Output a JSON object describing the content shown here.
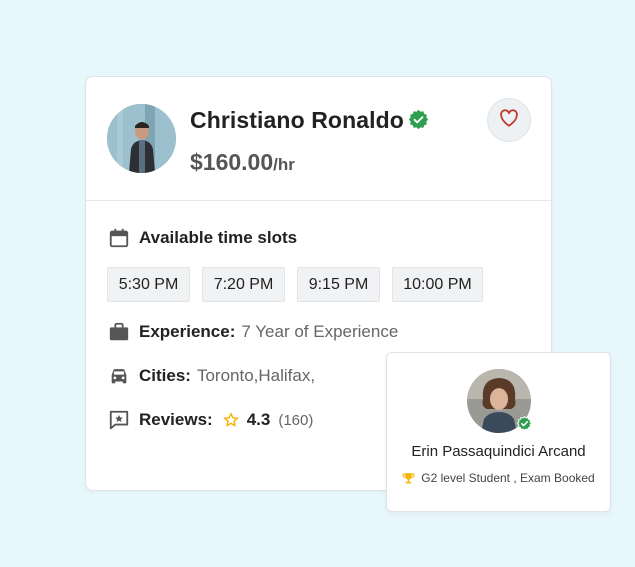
{
  "profile": {
    "name": "Christiano Ronaldo",
    "price": "$160.00",
    "price_unit": "/hr"
  },
  "availability": {
    "label": "Available time slots",
    "slots": [
      "5:30 PM",
      "7:20 PM",
      "9:15 PM",
      "10:00 PM"
    ]
  },
  "experience": {
    "label": "Experience:",
    "value": "7 Year of Experience"
  },
  "cities": {
    "label": "Cities:",
    "value": "Toronto,Halifax,"
  },
  "reviews": {
    "label": "Reviews:",
    "rating": "4.3",
    "count": "(160)"
  },
  "student": {
    "name": "Erin Passaquindici Arcand",
    "status": "G2 level Student , Exam Booked"
  },
  "colors": {
    "verified": "#2e9e4f",
    "star": "#f4b400",
    "heart": "#c0392b",
    "background": "#e8f7fb"
  },
  "icons": [
    "verified-icon",
    "heart-icon",
    "calendar-icon",
    "briefcase-icon",
    "car-icon",
    "review-icon",
    "star-icon",
    "trophy-icon"
  ]
}
